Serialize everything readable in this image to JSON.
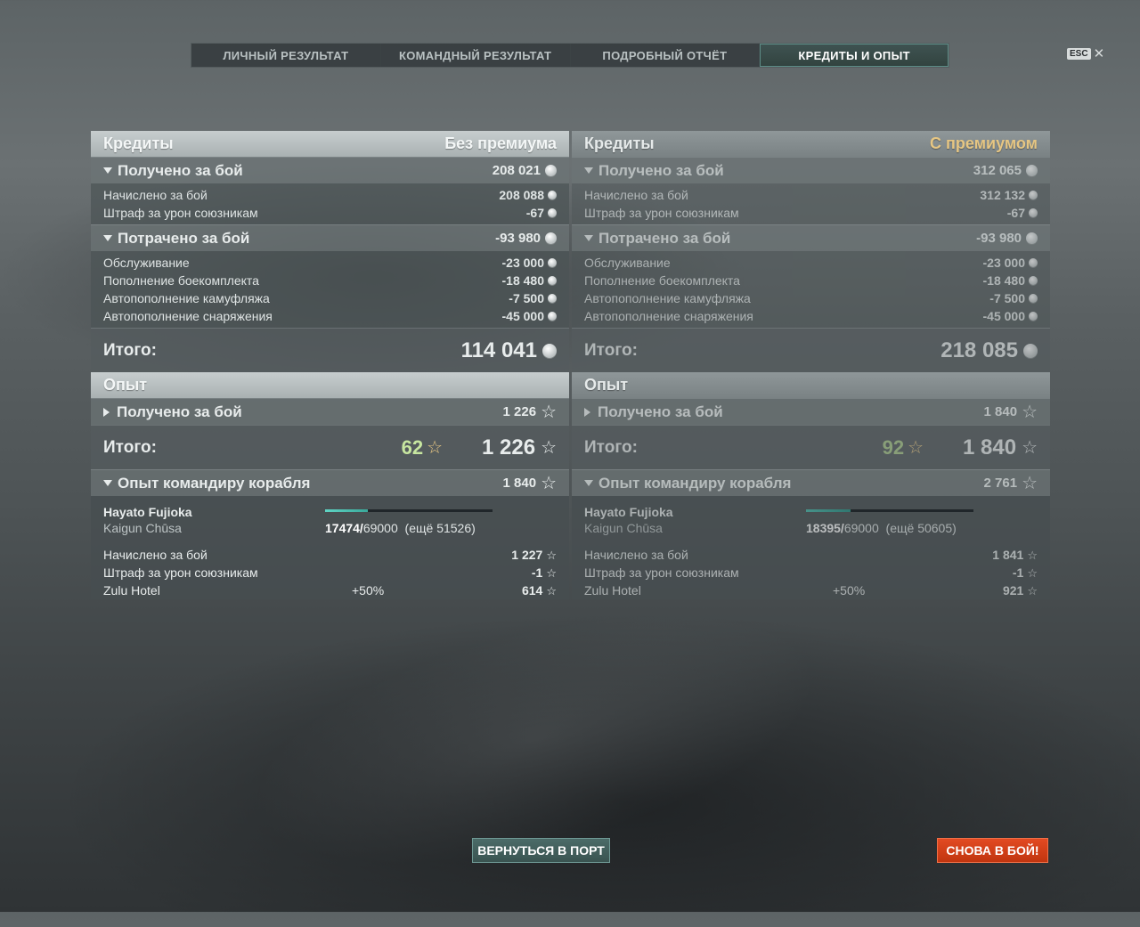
{
  "tabs": [
    "ЛИЧНЫЙ РЕЗУЛЬТАТ",
    "КОМАНДНЫЙ РЕЗУЛЬТАТ",
    "ПОДРОБНЫЙ ОТЧЁТ",
    "КРЕДИТЫ И ОПЫТ"
  ],
  "esc": "ESC",
  "left": {
    "credits_title": "Кредиты",
    "mode": "Без премиума",
    "earned_label": "Получено за бой",
    "earned_value": "208 021",
    "earned_rows": [
      {
        "label": "Начислено за бой",
        "value": "208 088"
      },
      {
        "label": "Штраф за урон союзникам",
        "value": "-67"
      }
    ],
    "spent_label": "Потрачено за бой",
    "spent_value": "-93 980",
    "spent_rows": [
      {
        "label": "Обслуживание",
        "value": "-23 000"
      },
      {
        "label": "Пополнение боекомплекта",
        "value": "-18 480"
      },
      {
        "label": "Автопополнение камуфляжа",
        "value": "-7 500"
      },
      {
        "label": "Автопополнение снаряжения",
        "value": "-45 000"
      }
    ],
    "total_label": "Итого:",
    "total_value": "114 041",
    "xp_title": "Опыт",
    "xp_earned_label": "Получено за бой",
    "xp_earned_value": "1 226",
    "xp_total_label": "Итого:",
    "xp_bonus": "62",
    "xp_total": "1 226",
    "cmdr_label": "Опыт командиру корабля",
    "cmdr_value": "1 840",
    "cmdr_name": "Hayato Fujioka",
    "cmdr_rank": "Kaigun Chūsa",
    "cmdr_xp_current": "17474/",
    "cmdr_xp_max": "69000",
    "cmdr_xp_left": "(ещё 51526)",
    "cmdr_progress": 0.2532,
    "cmdr_rows": [
      {
        "label": "Начислено за бой",
        "mid": "",
        "value": "1 227"
      },
      {
        "label": "Штраф за урон союзникам",
        "mid": "",
        "value": "-1"
      },
      {
        "label": "Zulu Hotel",
        "mid": "+50%",
        "value": "614"
      }
    ]
  },
  "right": {
    "credits_title": "Кредиты",
    "mode": "С премиумом",
    "earned_label": "Получено за бой",
    "earned_value": "312 065",
    "earned_rows": [
      {
        "label": "Начислено за бой",
        "value": "312 132"
      },
      {
        "label": "Штраф за урон союзникам",
        "value": "-67"
      }
    ],
    "spent_label": "Потрачено за бой",
    "spent_value": "-93 980",
    "spent_rows": [
      {
        "label": "Обслуживание",
        "value": "-23 000"
      },
      {
        "label": "Пополнение боекомплекта",
        "value": "-18 480"
      },
      {
        "label": "Автопополнение камуфляжа",
        "value": "-7 500"
      },
      {
        "label": "Автопополнение снаряжения",
        "value": "-45 000"
      }
    ],
    "total_label": "Итого:",
    "total_value": "218 085",
    "xp_title": "Опыт",
    "xp_earned_label": "Получено за бой",
    "xp_earned_value": "1 840",
    "xp_total_label": "Итого:",
    "xp_bonus": "92",
    "xp_total": "1 840",
    "cmdr_label": "Опыт командиру корабля",
    "cmdr_value": "2 761",
    "cmdr_name": "Hayato Fujioka",
    "cmdr_rank": "Kaigun Chūsa",
    "cmdr_xp_current": "18395/",
    "cmdr_xp_max": "69000",
    "cmdr_xp_left": "(ещё 50605)",
    "cmdr_progress": 0.2666,
    "cmdr_rows": [
      {
        "label": "Начислено за бой",
        "mid": "",
        "value": "1 841"
      },
      {
        "label": "Штраф за урон союзникам",
        "mid": "",
        "value": "-1"
      },
      {
        "label": "Zulu Hotel",
        "mid": "+50%",
        "value": "921"
      }
    ]
  },
  "buttons": {
    "port": "ВЕРНУТЬСЯ В ПОРТ",
    "battle": "СНОВА В БОЙ!"
  }
}
